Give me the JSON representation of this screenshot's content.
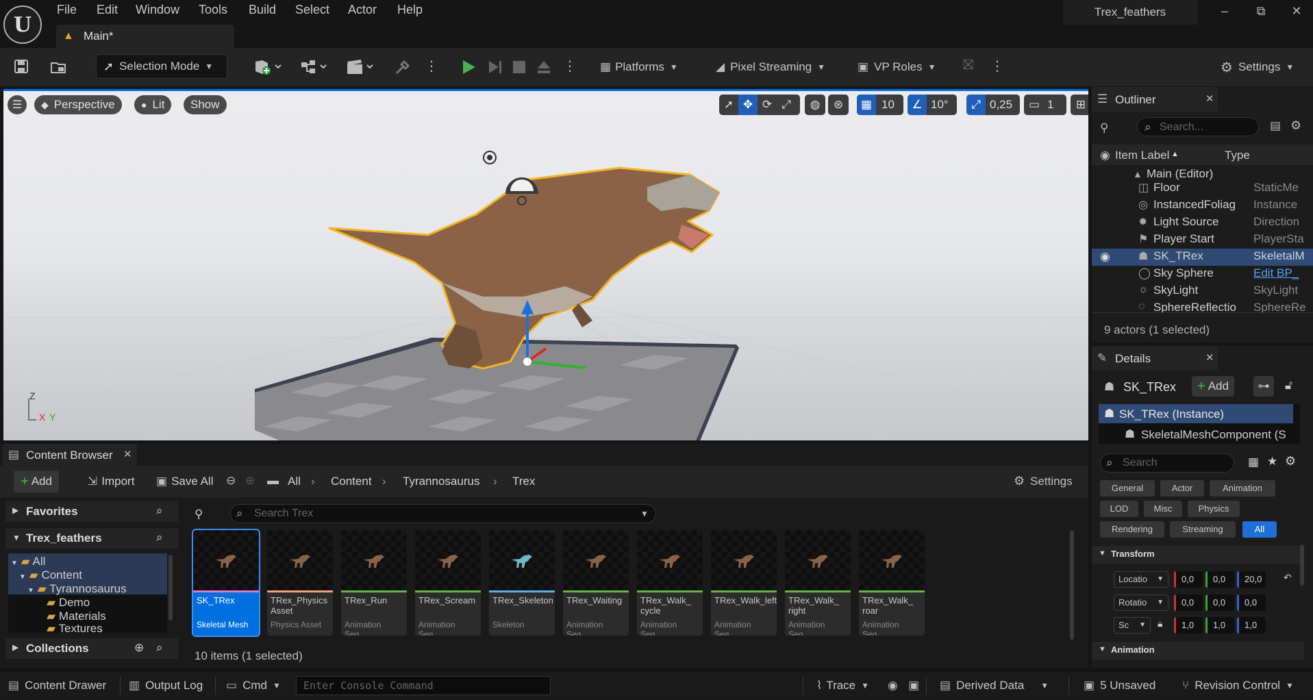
{
  "menu": {
    "items": [
      "File",
      "Edit",
      "Window",
      "Tools",
      "Build",
      "Select",
      "Actor",
      "Help"
    ]
  },
  "tab": {
    "title": "Main*"
  },
  "project": {
    "name": "Trex_feathers"
  },
  "window": {
    "minimize": "–",
    "restore": "⧉",
    "close": "✕"
  },
  "toolbar": {
    "selection_mode": "Selection Mode",
    "platforms": "Platforms",
    "pixel_streaming": "Pixel Streaming",
    "vp_roles": "VP Roles",
    "settings": "Settings"
  },
  "viewport": {
    "perspective": "Perspective",
    "lit": "Lit",
    "show": "Show",
    "grid_snap": "10",
    "rotation_snap": "10°",
    "scale_snap": "0,25",
    "camera_speed": "1",
    "axis_z": "Z",
    "axis_x": "X",
    "axis_y": "Y"
  },
  "outliner": {
    "title": "Outliner",
    "search_placeholder": "Search...",
    "col_label": "Item Label",
    "col_type": "Type",
    "root": "Main (Editor)",
    "items": [
      {
        "label": "Floor",
        "type": "StaticMe"
      },
      {
        "label": "InstancedFoliag",
        "type": "Instance"
      },
      {
        "label": "Light Source",
        "type": "Direction"
      },
      {
        "label": "Player Start",
        "type": "PlayerSta"
      },
      {
        "label": "SK_TRex",
        "type": "SkeletalM"
      },
      {
        "label": "Sky Sphere",
        "type": "Edit BP_"
      },
      {
        "label": "SkyLight",
        "type": "SkyLight"
      },
      {
        "label": "SphereReflectio",
        "type": "SphereRe"
      }
    ],
    "status": "9 actors (1 selected)"
  },
  "details": {
    "title": "Details",
    "actor_name": "SK_TRex",
    "add_label": "Add",
    "instance": "SK_TRex (Instance)",
    "component": "SkeletalMeshComponent (S",
    "search_placeholder": "Search",
    "filters": [
      "General",
      "Actor",
      "Animation",
      "LOD",
      "Misc",
      "Physics",
      "Rendering",
      "Streaming",
      "All"
    ],
    "transform_header": "Transform",
    "location_label": "Locatio",
    "location": [
      "0,0",
      "0,0",
      "20,0"
    ],
    "rotation_label": "Rotatio",
    "rotation": [
      "0,0",
      "0,0",
      "0,0"
    ],
    "scale_label": "Sc",
    "scale": [
      "1,0",
      "1,0",
      "1,0"
    ],
    "animation_header": "Animation"
  },
  "content_browser": {
    "title": "Content Browser",
    "add": "Add",
    "import": "Import",
    "save_all": "Save All",
    "breadcrumb": [
      "All",
      "Content",
      "Tyrannosaurus",
      "Trex"
    ],
    "settings": "Settings",
    "favorites": "Favorites",
    "project": "Trex_feathers",
    "tree": [
      "All",
      "Content",
      "Tyrannosaurus",
      "Demo",
      "Materials",
      "Textures"
    ],
    "collections": "Collections",
    "search_placeholder": "Search Trex",
    "assets": [
      {
        "name": "SK_TRex",
        "kind": "Skeletal Mesh"
      },
      {
        "name": "TRex_Physics Asset",
        "kind": "Physics Asset"
      },
      {
        "name": "TRex_Run",
        "kind": "Animation Seq..."
      },
      {
        "name": "TRex_Scream",
        "kind": "Animation Seq..."
      },
      {
        "name": "TRex_Skeleton",
        "kind": "Skeleton"
      },
      {
        "name": "TRex_Waiting",
        "kind": "Animation Seq..."
      },
      {
        "name": "TRex_Walk_ cycle",
        "kind": "Animation Seq..."
      },
      {
        "name": "TRex_Walk_left",
        "kind": "Animation Seq..."
      },
      {
        "name": "TRex_Walk_ right",
        "kind": "Animation Seq..."
      },
      {
        "name": "TRex_Walk_ roar",
        "kind": "Animation Seq..."
      }
    ],
    "count": "10 items (1 selected)"
  },
  "statusbar": {
    "content_drawer": "Content Drawer",
    "output_log": "Output Log",
    "cmd": "Cmd",
    "console_placeholder": "Enter Console Command",
    "trace": "Trace",
    "derived_data": "Derived Data",
    "unsaved": "5 Unsaved",
    "revision_control": "Revision Control"
  },
  "colors": {
    "accent": "#0070e0",
    "selection": "#2f4a74",
    "play": "#4caf50",
    "panel": "#1c1c1c"
  }
}
